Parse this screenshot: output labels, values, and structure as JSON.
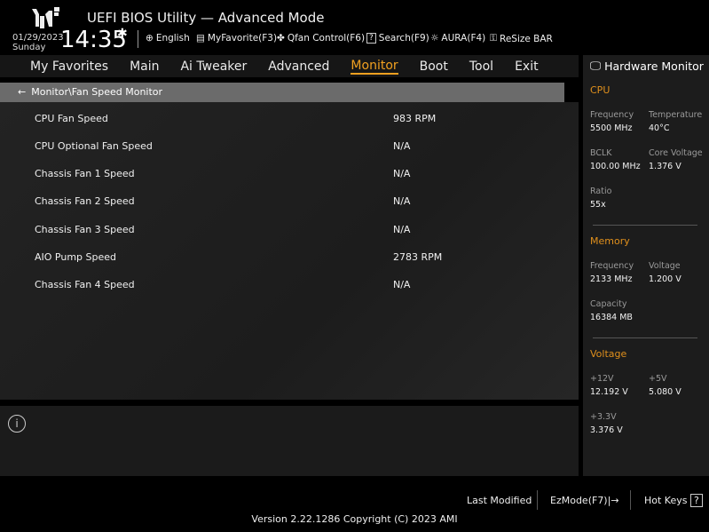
{
  "header": {
    "title": "UEFI BIOS Utility — Advanced Mode",
    "date": "01/29/2023",
    "day": "Sunday",
    "time": "14:35",
    "tools": [
      {
        "icon": "globe-icon",
        "label": "English"
      },
      {
        "icon": "favorite-icon",
        "label": "MyFavorite(F3)"
      },
      {
        "icon": "fan-icon",
        "label": "Qfan Control(F6)"
      },
      {
        "icon": "search-icon",
        "label": "Search(F9)"
      },
      {
        "icon": "aura-icon",
        "label": "AURA(F4)"
      },
      {
        "icon": "resize-bar-icon",
        "label": "ReSize BAR"
      }
    ]
  },
  "nav": {
    "tabs": [
      "My Favorites",
      "Main",
      "Ai Tweaker",
      "Advanced",
      "Monitor",
      "Boot",
      "Tool",
      "Exit"
    ],
    "active": "Monitor"
  },
  "breadcrumb": "Monitor\\Fan Speed Monitor",
  "fans": [
    {
      "label": "CPU Fan Speed",
      "value": "983 RPM"
    },
    {
      "label": "CPU Optional Fan Speed",
      "value": "N/A"
    },
    {
      "label": "Chassis Fan 1 Speed",
      "value": "N/A"
    },
    {
      "label": "Chassis Fan 2 Speed",
      "value": "N/A"
    },
    {
      "label": "Chassis Fan 3 Speed",
      "value": "N/A"
    },
    {
      "label": "AIO Pump Speed",
      "value": "2783 RPM"
    },
    {
      "label": "Chassis Fan 4 Speed",
      "value": "N/A"
    }
  ],
  "hw": {
    "title": "Hardware Monitor",
    "cpu": {
      "title": "CPU",
      "freq_l": "Frequency",
      "freq": "5500 MHz",
      "temp_l": "Temperature",
      "temp": "40°C",
      "bclk_l": "BCLK",
      "bclk": "100.00 MHz",
      "cv_l": "Core Voltage",
      "cv": "1.376 V",
      "ratio_l": "Ratio",
      "ratio": "55x"
    },
    "mem": {
      "title": "Memory",
      "freq_l": "Frequency",
      "freq": "2133 MHz",
      "volt_l": "Voltage",
      "volt": "1.200 V",
      "cap_l": "Capacity",
      "cap": "16384 MB"
    },
    "volt": {
      "title": "Voltage",
      "v12_l": "+12V",
      "v12": "12.192 V",
      "v5_l": "+5V",
      "v5": "5.080 V",
      "v33_l": "+3.3V",
      "v33": "3.376 V"
    }
  },
  "footer": {
    "last_modified": "Last Modified",
    "ezmode": "EzMode(F7)|",
    "hotkeys": "Hot Keys",
    "hotkeys_icon": "?",
    "version": "Version 2.22.1286 Copyright (C) 2023 AMI"
  },
  "colors": {
    "accent": "#f0a020"
  }
}
